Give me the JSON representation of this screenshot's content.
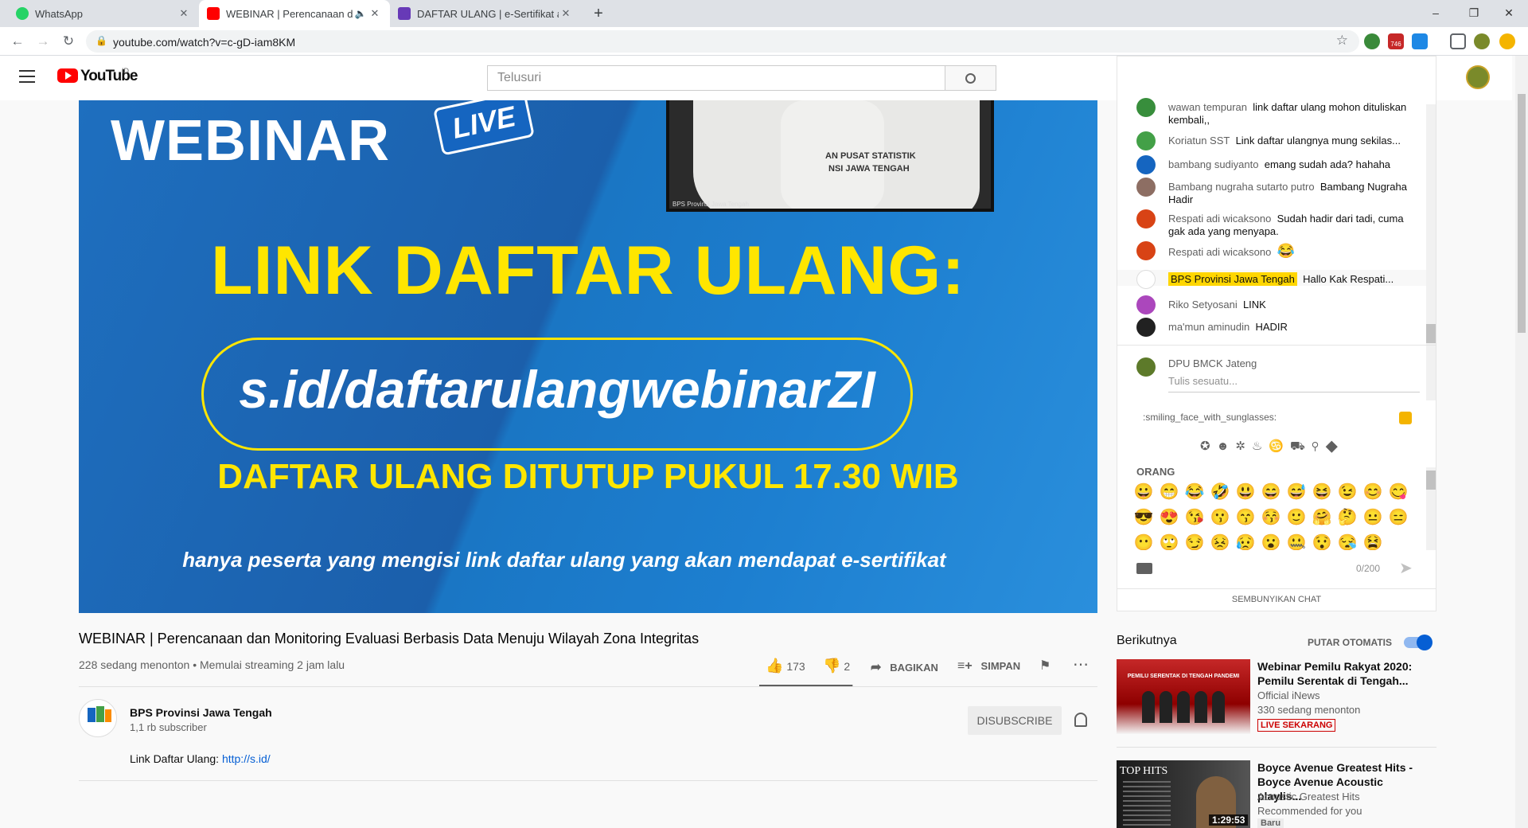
{
  "browser": {
    "tabs": [
      {
        "title": "WhatsApp",
        "color": "#25d366"
      },
      {
        "title": "WEBINAR | Perencanaan dan Monitoring",
        "color": "#ff0000"
      },
      {
        "title": "DAFTAR ULANG | e-Sertifikat akan",
        "color": "#673ab7"
      }
    ],
    "url": "youtube.com/watch?v=c-gD-iam8KM",
    "new_tab": "+",
    "window_buttons": [
      "–",
      "❐",
      "✕"
    ],
    "ext_badge": "746"
  },
  "youtube": {
    "logo_text": "YouTube",
    "region": "ID",
    "search_placeholder": "Telusuri"
  },
  "player": {
    "heading": "WEBINAR",
    "live_badge": "LIVE",
    "banner_title": "LINK DAFTAR ULANG:",
    "link": "s.id/daftarulangwebinarZI",
    "closing": "DAFTAR ULANG DITUTUP PUKUL 17.30 WIB",
    "footnote": "hanya peserta yang mengisi link daftar ulang yang akan mendapat e-sertifikat",
    "cam_text1": "AN PUSAT STATISTIK",
    "cam_text2": "NSI JAWA TENGAH",
    "cam_caption": "BPS Provinsi Jawa Tengah"
  },
  "video": {
    "title": "WEBINAR | Perencanaan dan Monitoring Evaluasi Berbasis Data Menuju Wilayah Zona Integritas",
    "views": "228 sedang menonton • Memulai streaming 2 jam lalu",
    "likes": "173",
    "dislikes": "2",
    "share": "BAGIKAN",
    "save": "SIMPAN",
    "like_ratio": 0.99
  },
  "channel": {
    "name": "BPS Provinsi Jawa Tengah",
    "subs": "1,1 rb subscriber",
    "subscribe": "DISUBSCRIBE",
    "desc_label": "Link Daftar Ulang: ",
    "desc_link": "http://s.id/"
  },
  "chat": {
    "messages": [
      {
        "author": "wawan tempuran",
        "text": "link daftar ulang mohon dituliskan kembali,,",
        "color": "#388e3c"
      },
      {
        "author": "Koriatun SST",
        "text": "Link daftar ulangnya mung sekilas...",
        "color": "#43a047"
      },
      {
        "author": "bambang sudiyanto",
        "text": "emang sudah ada? hahaha",
        "color": "#1565c0"
      },
      {
        "author": "Bambang nugraha sutarto putro",
        "text": "Bambang Nugraha Hadir",
        "color": "#8d6e63"
      },
      {
        "author": "Respati adi wicaksono",
        "text": "Sudah hadir dari tadi, cuma gak ada yang menyapa.",
        "color": "#d84315"
      },
      {
        "author": "Respati adi wicaksono",
        "text": "😂",
        "color": "#d84315"
      },
      {
        "author": "BPS Provinsi Jawa Tengah",
        "text": "Hallo Kak Respati...",
        "color": "#ffffff"
      },
      {
        "author": "Riko Setyosani",
        "text": "LINK",
        "color": "#ab47bc"
      },
      {
        "author": "ma'mun aminudin",
        "text": "HADIR",
        "color": "#212121"
      }
    ],
    "input_author": "DPU BMCK Jateng",
    "input_placeholder": "Tulis sesuatu...",
    "emoji_search": ":smiling_face_with_sunglasses:",
    "category": "ORANG",
    "emojis": [
      "😀",
      "😁",
      "😂",
      "🤣",
      "😃",
      "😄",
      "😅",
      "😆",
      "😉",
      "😊",
      "😋",
      "😎",
      "😍",
      "😘",
      "😗",
      "😙",
      "😚",
      "🙂",
      "🤗",
      "🤔",
      "😐",
      "😑",
      "😶",
      "🙄",
      "😏",
      "😣",
      "😥",
      "😮",
      "🤐",
      "😯",
      "😪",
      "😫"
    ],
    "counter": "0/200",
    "hide": "SEMBUNYIKAN CHAT"
  },
  "upnext": {
    "label": "Berikutnya",
    "autoplay": "PUTAR OTOMATIS",
    "autoplay_on": true,
    "items": [
      {
        "title": "Webinar Pemilu Rakyat 2020: Pemilu Serentak di Tengah...",
        "channel": "Official iNews",
        "meta": "330 sedang menonton",
        "badge": "LIVE SEKARANG",
        "thumb_text": "PEMILU SERENTAK DI TENGAH PANDEMI"
      },
      {
        "title": "Boyce Avenue Greatest Hits - Boyce Avenue Acoustic playlis...",
        "channel": "Acoustic Greatest Hits",
        "meta": "Recommended for you",
        "badge": "Baru",
        "thumb_text": "TOP HITS",
        "duration": "1:29:53"
      }
    ]
  }
}
